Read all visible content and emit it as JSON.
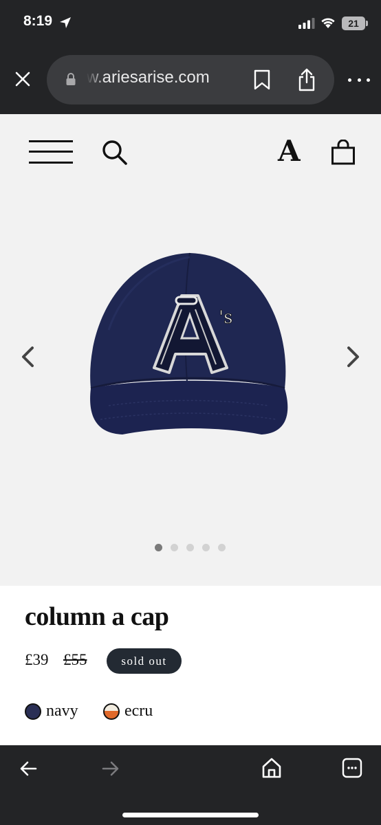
{
  "status_bar": {
    "time": "8:19",
    "battery_level": "21"
  },
  "browser": {
    "url": "w.ariesarise.com",
    "icons": [
      "close-icon",
      "lock-icon",
      "bookmark-icon",
      "share-icon",
      "more-icon"
    ]
  },
  "site_header": {
    "logo": "A",
    "icons": [
      "hamburger-menu-icon",
      "search-icon",
      "shopping-bag-icon"
    ]
  },
  "gallery": {
    "image_count": 5,
    "active_index": 0,
    "cap_color": "#1f2752",
    "patch_text": "A's"
  },
  "product": {
    "title": "column a cap",
    "price": "£39",
    "original_price": "£55",
    "status_badge": "sold out",
    "colors": [
      {
        "label": "navy",
        "swatch": "#2a2f55"
      },
      {
        "label": "ecru",
        "swatch_top": "#f2ece0",
        "swatch_bottom": "#e0692a"
      }
    ]
  },
  "bottom_toolbar": {
    "icons": [
      "back-arrow-icon",
      "forward-arrow-icon",
      "home-icon",
      "tabs-icon"
    ]
  }
}
